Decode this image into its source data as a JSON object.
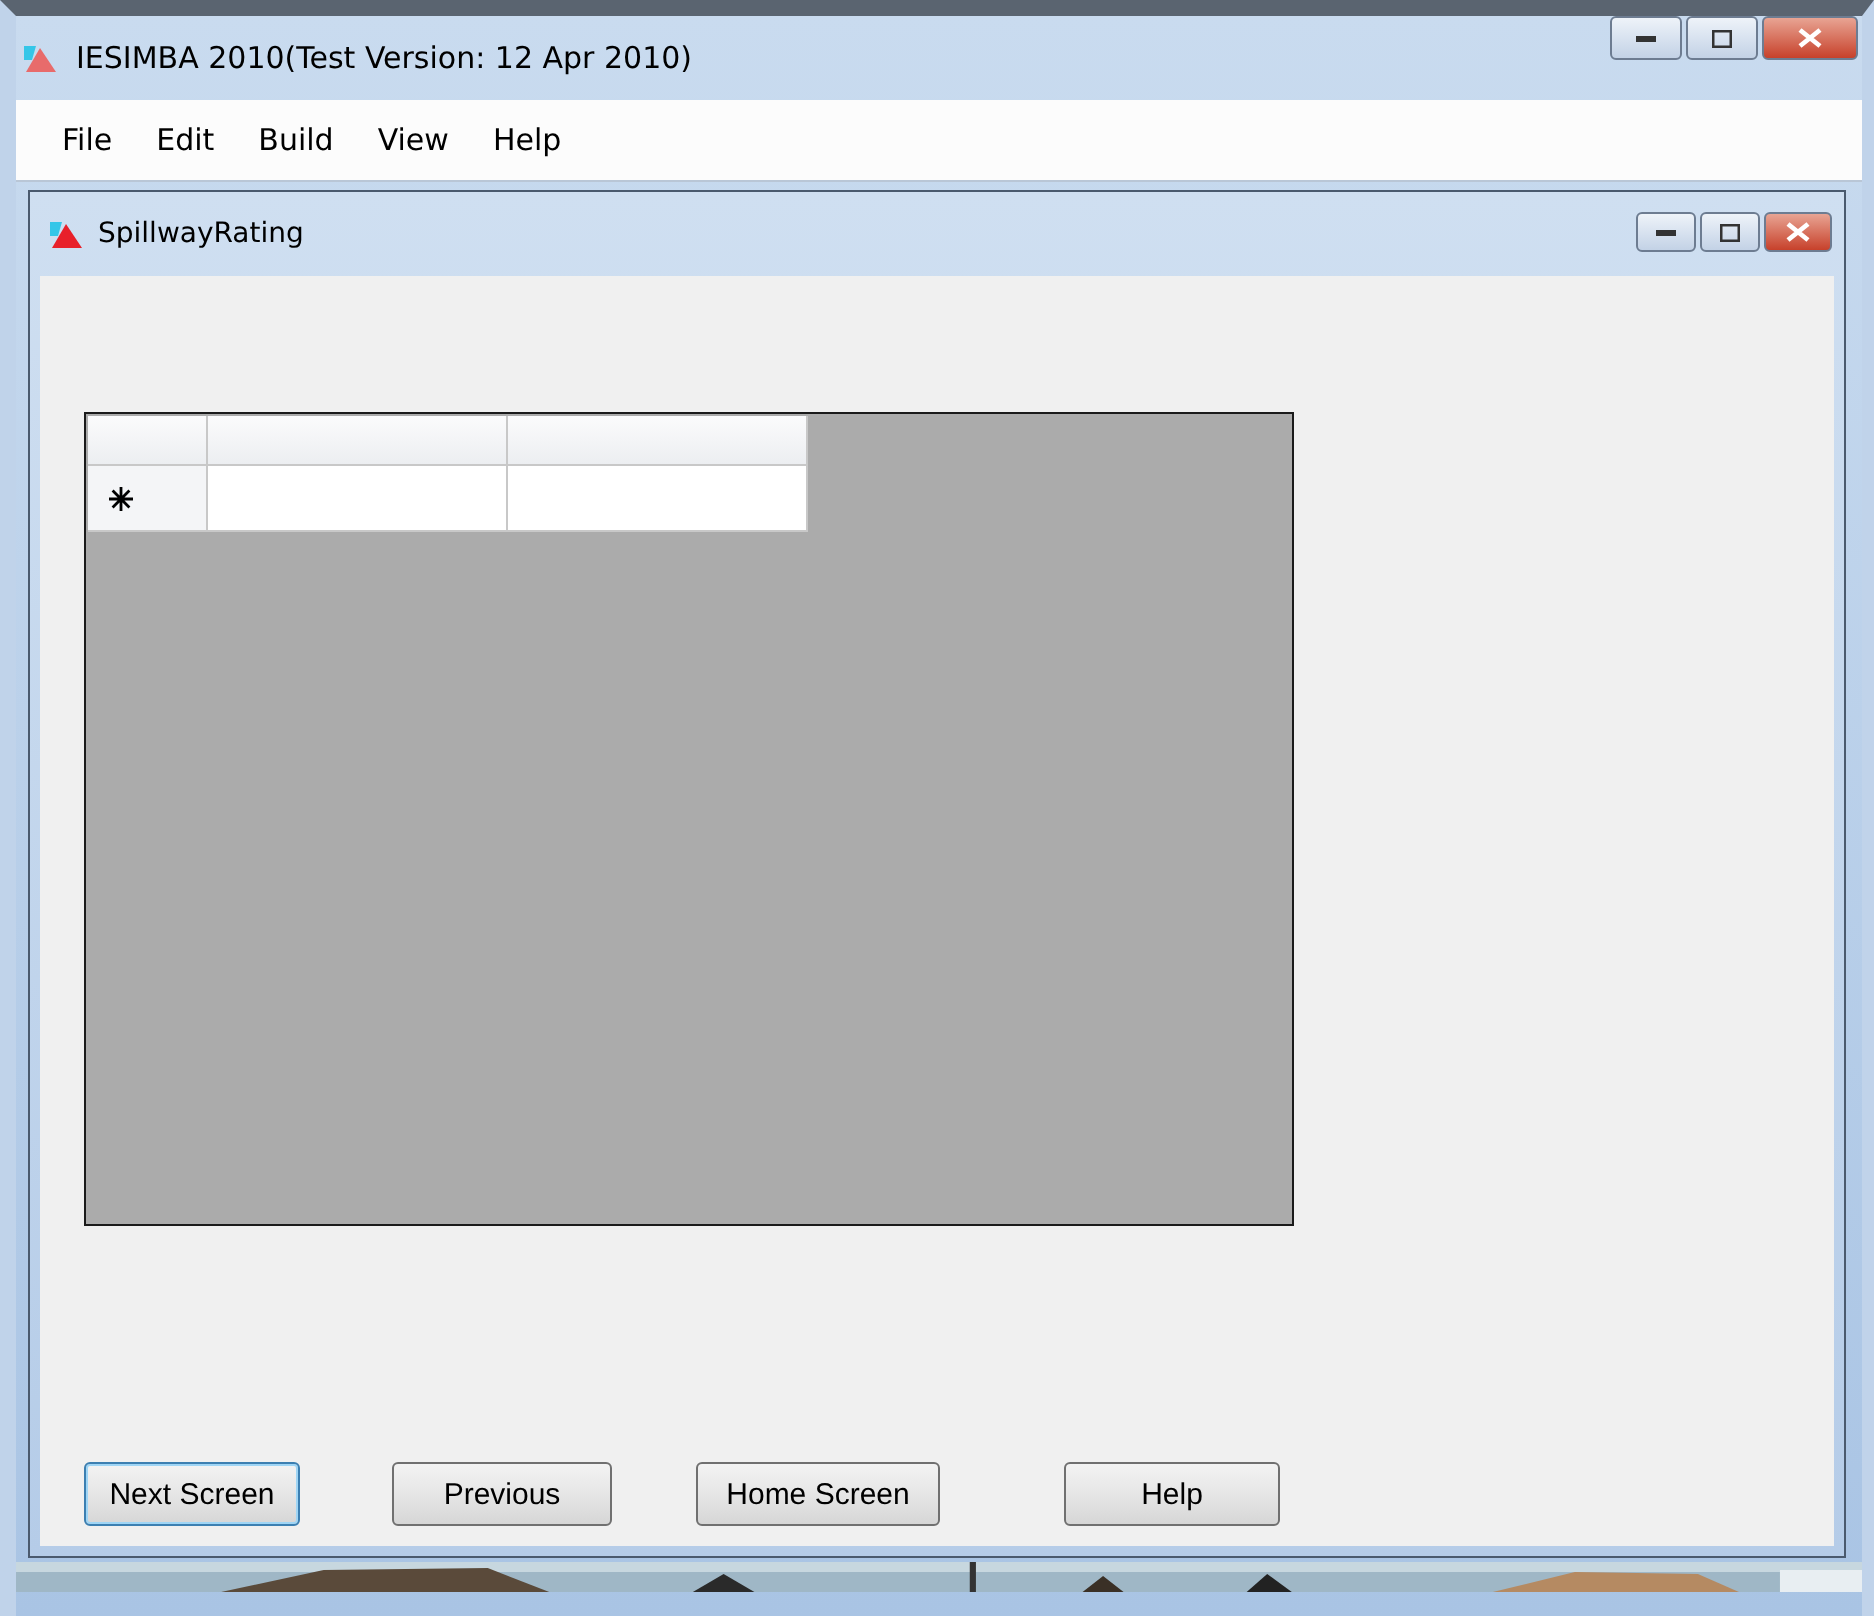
{
  "window": {
    "title": "IESIMBA 2010(Test Version: 12 Apr 2010)"
  },
  "menu": [
    "File",
    "Edit",
    "Build",
    "View",
    "Help"
  ],
  "child_window": {
    "title": "SpillwayRating"
  },
  "grid": {
    "new_row": true
  },
  "buttons": [
    {
      "label": "Next Screen",
      "default": true
    },
    {
      "label": "Previous",
      "default": false
    },
    {
      "label": "Home Screen",
      "default": false
    },
    {
      "label": "Help",
      "default": false
    }
  ]
}
